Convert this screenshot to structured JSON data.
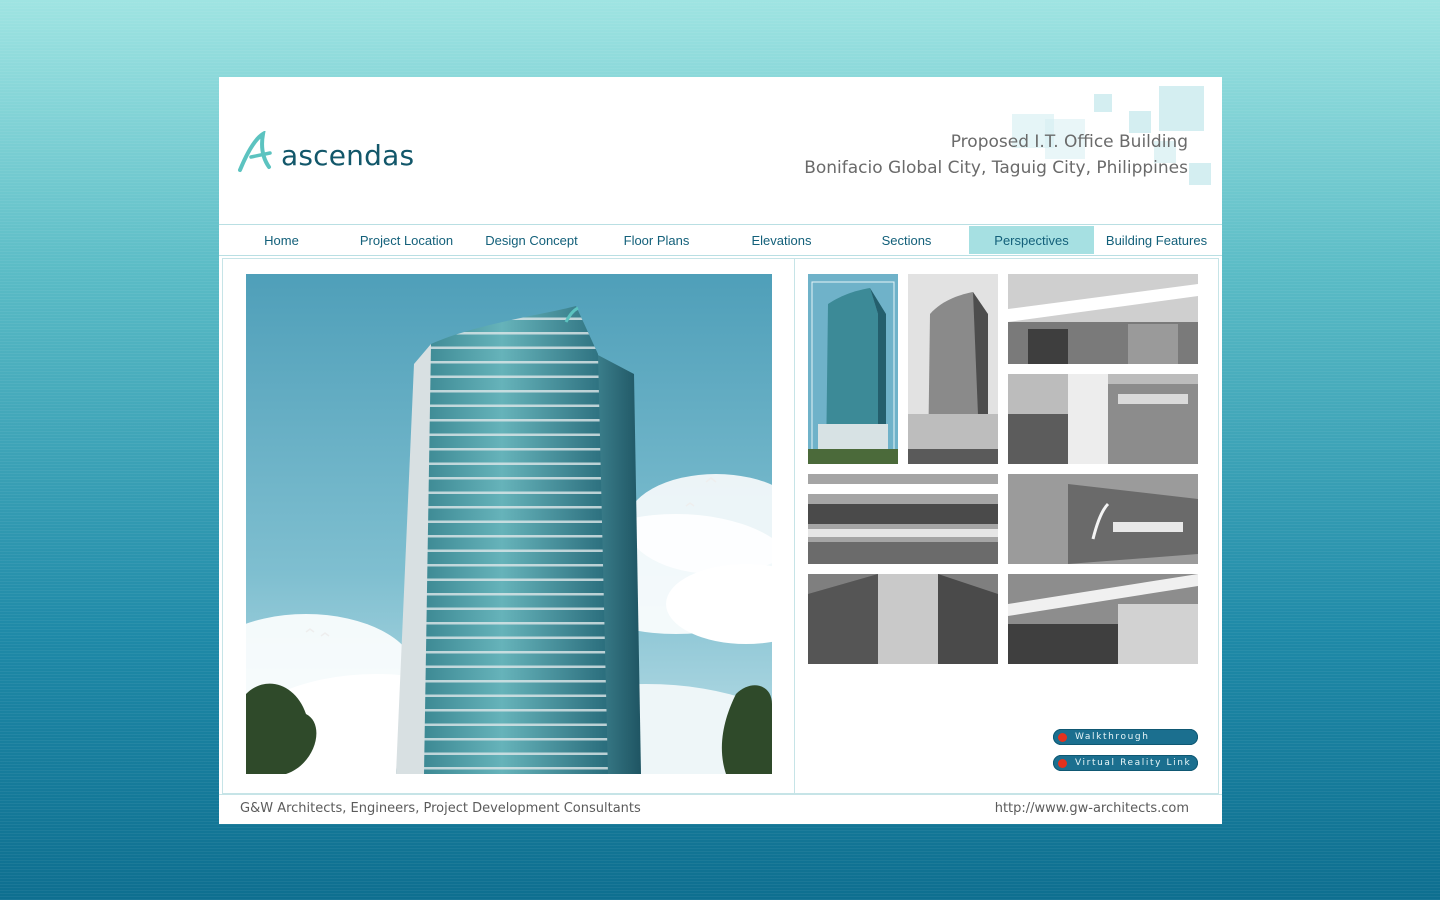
{
  "brand": {
    "name": "ascendas"
  },
  "header": {
    "title_line1": "Proposed I.T. Office Building",
    "title_line2": "Bonifacio Global City, Taguig City, Philippines"
  },
  "nav": {
    "items": [
      {
        "label": "Home"
      },
      {
        "label": "Project Location"
      },
      {
        "label": "Design Concept"
      },
      {
        "label": "Floor Plans"
      },
      {
        "label": "Elevations"
      },
      {
        "label": "Sections"
      },
      {
        "label": "Perspectives",
        "active": true
      },
      {
        "label": "Building Features"
      }
    ]
  },
  "links": {
    "walkthrough": "Walkthrough",
    "virtual_reality": "Virtual Reality Link"
  },
  "footer": {
    "company": "G&W Architects, Engineers, Project Development Consultants",
    "url": "http://www.gw-architects.com"
  },
  "colors": {
    "accent": "#a6e0e2",
    "nav_text": "#13607a",
    "pill": "#1b6f8f",
    "pill_dot": "#e3321e"
  }
}
